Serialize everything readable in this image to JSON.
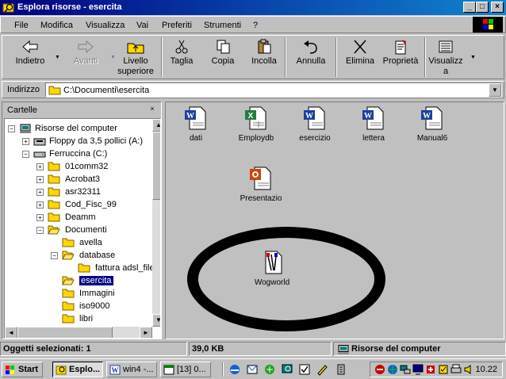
{
  "window": {
    "title": "Esplora risorse - esercita",
    "minimize": "_",
    "maximize": "□",
    "close": "×"
  },
  "menu": [
    "File",
    "Modifica",
    "Visualizza",
    "Vai",
    "Preferiti",
    "Strumenti",
    "?"
  ],
  "toolbar": {
    "back": "Indietro",
    "forward": "Avanti",
    "up_line1": "Livello",
    "up_line2": "superiore",
    "cut": "Taglia",
    "copy": "Copia",
    "paste": "Incolla",
    "undo": "Annulla",
    "delete": "Elimina",
    "properties": "Proprietà",
    "views_line1": "Visualizz",
    "views_line2": "a"
  },
  "address": {
    "label": "Indirizzo",
    "value": "C:\\Documenti\\esercita"
  },
  "folders": {
    "header": "Cartelle",
    "close": "×",
    "tree": [
      {
        "label": "Risorse del computer"
      },
      {
        "label": "Floppy da 3,5 pollici (A:)"
      },
      {
        "label": "Ferruccina (C:)"
      },
      {
        "label": "01comm32"
      },
      {
        "label": "Acrobat3"
      },
      {
        "label": "asr32311"
      },
      {
        "label": "Cod_Fisc_99"
      },
      {
        "label": "Deamm"
      },
      {
        "label": "Documenti"
      },
      {
        "label": "avella"
      },
      {
        "label": "database"
      },
      {
        "label": "fattura adsl_file"
      },
      {
        "label": "esercita"
      },
      {
        "label": "Immagini"
      },
      {
        "label": "iso9000"
      },
      {
        "label": "libri"
      }
    ]
  },
  "files": [
    {
      "name": "dati",
      "type": "word"
    },
    {
      "name": "Employdb",
      "type": "excel"
    },
    {
      "name": "esercizio",
      "type": "word"
    },
    {
      "name": "lettera",
      "type": "word"
    },
    {
      "name": "Manual6",
      "type": "word"
    },
    {
      "name": "Presentazio",
      "type": "powerpoint"
    },
    {
      "name": "Wogworld",
      "type": "program"
    }
  ],
  "status": {
    "selected": "Oggetti selezionati: 1",
    "size": "39,0 KB",
    "location": "Risorse del computer"
  },
  "taskbar": {
    "start": "Start",
    "buttons": [
      "Esplo...",
      "win4 -...",
      "[13] 0..."
    ],
    "clock": "10.22"
  }
}
